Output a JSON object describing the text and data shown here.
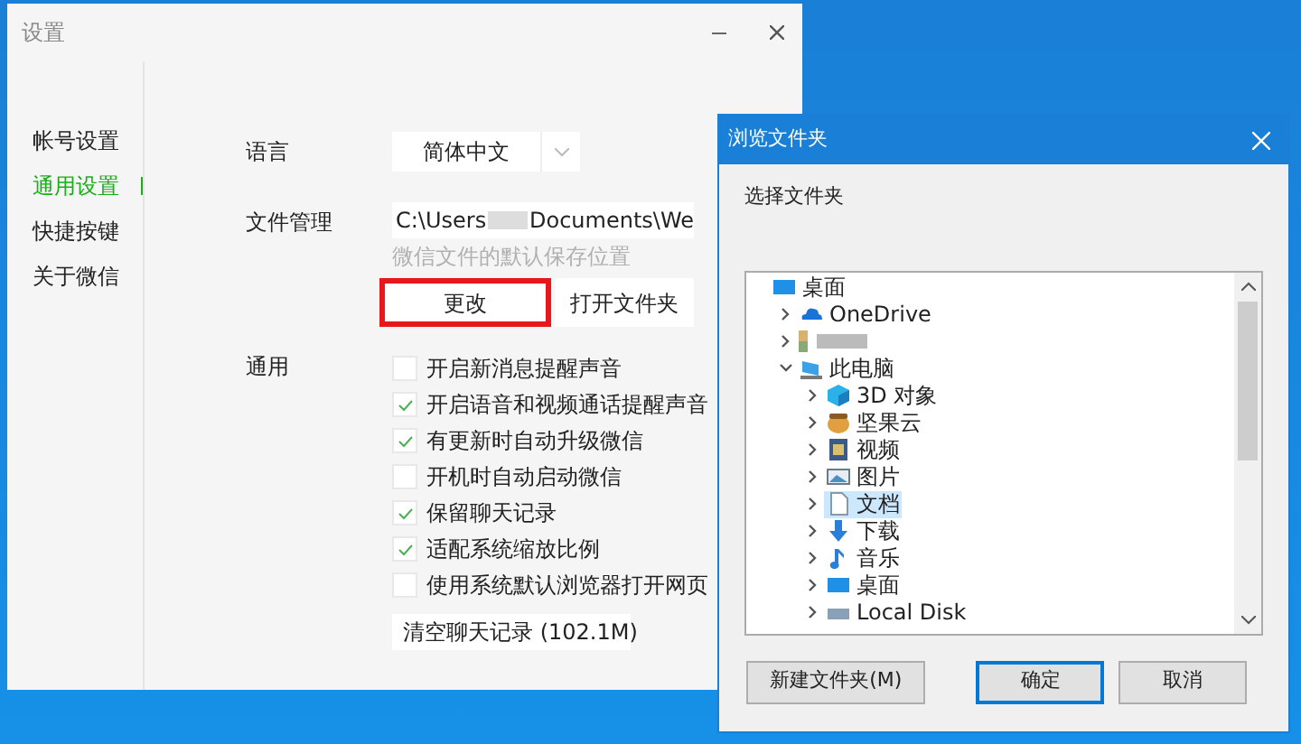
{
  "settings_window": {
    "title": "设置",
    "sidebar": {
      "items": [
        {
          "label": "帐号设置",
          "selected": false
        },
        {
          "label": "通用设置",
          "selected": true
        },
        {
          "label": "快捷按键",
          "selected": false
        },
        {
          "label": "关于微信",
          "selected": false
        }
      ]
    },
    "language": {
      "label": "语言",
      "value": "简体中文"
    },
    "file_management": {
      "label": "文件管理",
      "path": "C:\\Users",
      "path_rest": "Documents\\We",
      "hint": "微信文件的默认保存位置",
      "buttons": [
        {
          "label": "更改",
          "highlighted": true
        },
        {
          "label": "打开文件夹",
          "highlighted": false
        }
      ]
    },
    "general": {
      "label": "通用",
      "options": [
        {
          "label": "开启新消息提醒声音",
          "checked": false
        },
        {
          "label": "开启语音和视频通话提醒声音",
          "checked": true
        },
        {
          "label": "有更新时自动升级微信",
          "checked": true
        },
        {
          "label": "开机时自动启动微信",
          "checked": false
        },
        {
          "label": "保留聊天记录",
          "checked": true
        },
        {
          "label": "适配系统缩放比例",
          "checked": true
        },
        {
          "label": "使用系统默认浏览器打开网页",
          "checked": false
        }
      ],
      "clear_button": "清空聊天记录 (102.1M)"
    }
  },
  "browse_dialog": {
    "title": "浏览文件夹",
    "prompt": "选择文件夹",
    "tree": [
      {
        "label": "桌面",
        "kind": "desktop",
        "selected": false,
        "children": [
          {
            "label": "OneDrive",
            "kind": "cloud",
            "selected": false,
            "expanded": false
          },
          {
            "kind": "blurred",
            "selected": false,
            "expanded": false
          },
          {
            "label": "此电脑",
            "kind": "pc",
            "selected": false,
            "expanded": true,
            "children": [
              {
                "label": "3D 对象",
                "kind": "cube",
                "selected": false,
                "expanded": false
              },
              {
                "label": "坚果云",
                "kind": "nut",
                "selected": false,
                "expanded": false
              },
              {
                "label": "视频",
                "kind": "video",
                "selected": false,
                "expanded": false
              },
              {
                "label": "图片",
                "kind": "picture",
                "selected": false,
                "expanded": false
              },
              {
                "label": "文档",
                "kind": "document",
                "selected": true,
                "expanded": false
              },
              {
                "label": "下载",
                "kind": "download",
                "selected": false,
                "expanded": false
              },
              {
                "label": "音乐",
                "kind": "music",
                "selected": false,
                "expanded": false
              },
              {
                "label": "桌面",
                "kind": "desktop",
                "selected": false,
                "expanded": false
              },
              {
                "label": "Local Disk",
                "kind": "disk",
                "selected": false,
                "expanded": false
              }
            ]
          }
        ]
      }
    ],
    "buttons": [
      {
        "label": "新建文件夹(M)",
        "default": false
      },
      {
        "label": "确定",
        "default": true
      },
      {
        "label": "取消",
        "default": false
      }
    ]
  }
}
